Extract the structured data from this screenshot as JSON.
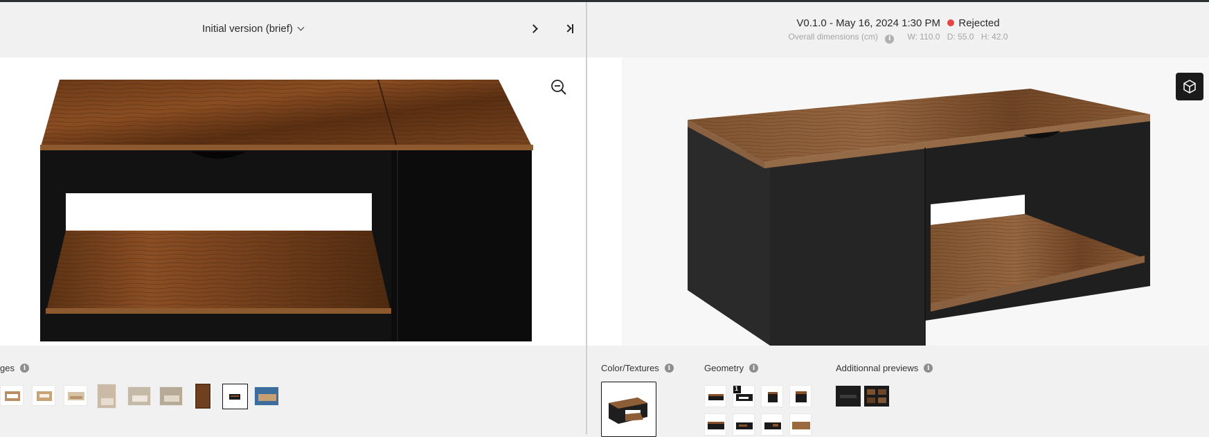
{
  "left": {
    "version_select": "Initial version (brief)",
    "images_label": "ges",
    "thumbnail_count": 9
  },
  "right": {
    "version_line": "V0.1.0 - May 16, 2024 1:30 PM",
    "status": "Rejected",
    "status_color": "#e64545",
    "dimensions_label": "Overall dimensions (cm)",
    "dim_w": "W: 110.0",
    "dim_d": "D: 55.0",
    "dim_h": "H: 42.0",
    "color_textures_label": "Color/Textures",
    "geometry_label": "Geometry",
    "additional_label": "Additionnal previews",
    "geometry_badge": "1"
  },
  "icons": [
    "chevron-down-icon",
    "next-arrow-icon",
    "last-arrow-icon",
    "zoom-out-icon",
    "cube-icon",
    "info-icon"
  ]
}
